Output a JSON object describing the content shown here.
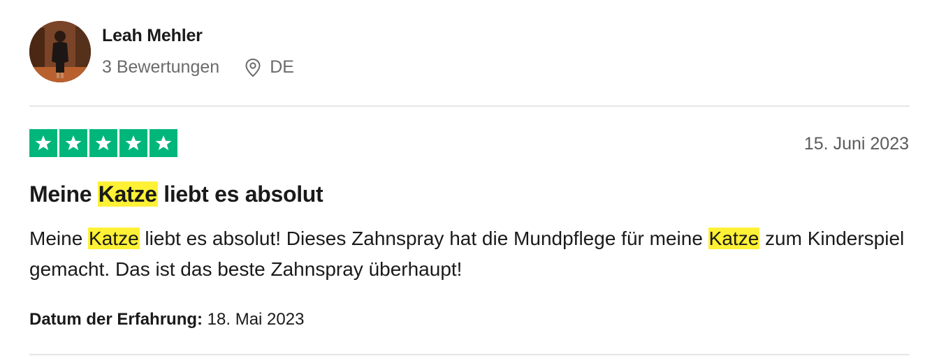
{
  "reviewer": {
    "name": "Leah Mehler",
    "review_count": "3 Bewertungen",
    "country": "DE"
  },
  "review": {
    "rating": 5,
    "max_rating": 5,
    "star_color": "#00b67a",
    "date": "15. Juni 2023",
    "title_before": "Meine ",
    "title_highlight": "Katze",
    "title_after": " liebt es absolut",
    "body_part1": "Meine ",
    "body_hl1": "Katze",
    "body_part2": " liebt es absolut! Dieses Zahnspray hat die Mundpflege für meine ",
    "body_hl2": "Katze",
    "body_part3": " zum Kinderspiel gemacht. Das ist das beste Zahnspray überhaupt!",
    "highlight_color": "#fff135",
    "experience_label": "Datum der Erfahrung:",
    "experience_date": " 18. Mai 2023"
  }
}
